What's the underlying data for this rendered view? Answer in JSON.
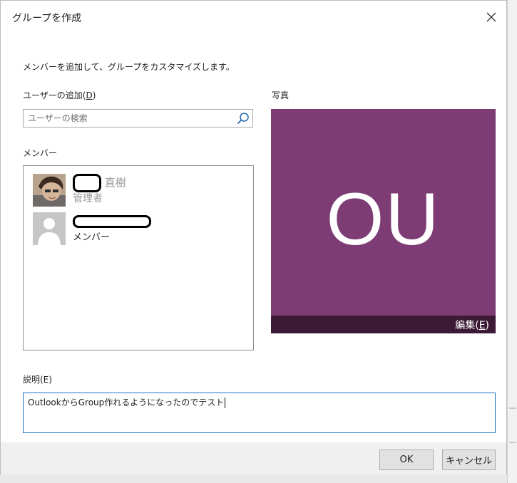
{
  "dialog": {
    "title": "グループを作成",
    "instruction": "メンバーを追加して、グループをカスタマイズします。"
  },
  "add_user": {
    "label_prefix": "ユーザーの追加(",
    "label_key": "D",
    "label_suffix": ")",
    "search_placeholder": "ユーザーの検索"
  },
  "members": {
    "label": "メンバー",
    "items": [
      {
        "name_visible": "直樹",
        "name_redacted": true,
        "role": "管理者"
      },
      {
        "name_visible": "",
        "name_redacted": true,
        "role": "メンバー"
      }
    ]
  },
  "photo": {
    "label": "写真",
    "initials": "OU",
    "background_color": "#7e3c75",
    "edit_prefix": "編集(",
    "edit_key": "E",
    "edit_suffix": ")"
  },
  "description": {
    "label": "説明(E)",
    "value": "OutlookからGroup作れるようになったのでテスト"
  },
  "footer": {
    "ok_label": "OK",
    "cancel_label": "キャンセル"
  }
}
